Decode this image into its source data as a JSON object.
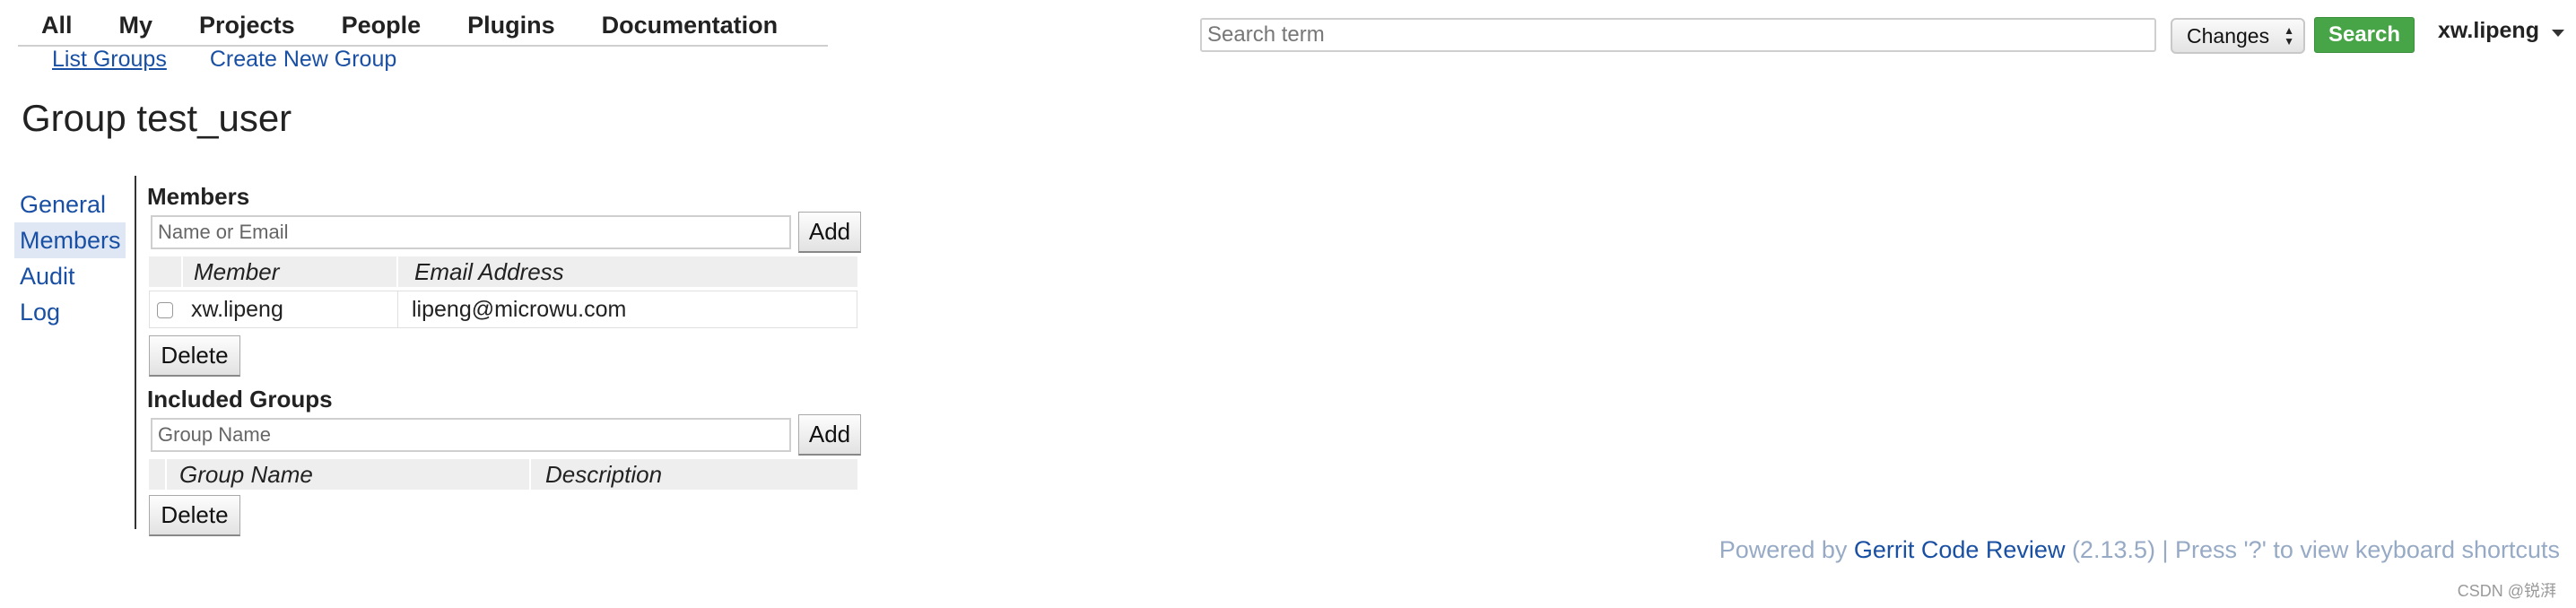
{
  "top_nav": {
    "items": [
      "All",
      "My",
      "Projects",
      "People",
      "Plugins",
      "Documentation"
    ]
  },
  "sub_nav": {
    "list_groups": "List Groups",
    "create_group": "Create New Group"
  },
  "search": {
    "placeholder": "Search term",
    "scope": "Changes",
    "button": "Search"
  },
  "user": {
    "name": "xw.lipeng",
    "menu_icon": "caret-down-icon"
  },
  "page": {
    "title": "Group test_user"
  },
  "side_menu": {
    "items": [
      "General",
      "Members",
      "Audit Log"
    ],
    "active": "Members"
  },
  "members": {
    "title": "Members",
    "input_placeholder": "Name or Email",
    "add_label": "Add",
    "headers": [
      "Member",
      "Email Address"
    ],
    "rows": [
      {
        "member": "xw.lipeng",
        "email": "lipeng@microwu.com",
        "checked": false
      }
    ],
    "delete_label": "Delete"
  },
  "included_groups": {
    "title": "Included Groups",
    "input_placeholder": "Group Name",
    "add_label": "Add",
    "headers": [
      "Group Name",
      "Description"
    ],
    "delete_label": "Delete"
  },
  "footer": {
    "prefix": "Powered by ",
    "link": "Gerrit Code Review",
    "suffix": " (2.13.5) | Press '?' to view keyboard shortcuts"
  },
  "watermark": "CSDN @锐湃",
  "colors": {
    "link": "#1a50a3",
    "search_button": "#47a447",
    "active_bg": "#dfe7f4",
    "footer_text": "#97aac5"
  }
}
